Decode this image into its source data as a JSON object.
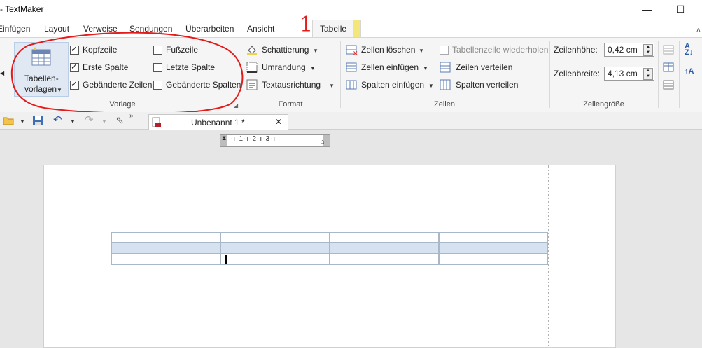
{
  "window": {
    "title": "- TextMaker"
  },
  "tabs": [
    "Einfügen",
    "Layout",
    "Verweise",
    "Sendungen",
    "Überarbeiten",
    "Ansicht",
    "Tabelle"
  ],
  "annotation_number": "1",
  "ribbon": {
    "vorlage": {
      "big_button": {
        "line1": "Tabellen-",
        "line2": "vorlagen"
      },
      "checkboxes": [
        {
          "label": "Kopfzeile",
          "checked": true
        },
        {
          "label": "Erste Spalte",
          "checked": true
        },
        {
          "label": "Gebänderte Zeilen",
          "checked": true
        },
        {
          "label": "Fußzeile",
          "checked": false
        },
        {
          "label": "Letzte Spalte",
          "checked": false
        },
        {
          "label": "Gebänderte Spalten",
          "checked": false
        }
      ],
      "label": "Vorlage"
    },
    "format": {
      "items": [
        "Schattierung",
        "Umrandung",
        "Textausrichtung"
      ],
      "label": "Format"
    },
    "zellen": {
      "items": [
        "Zellen löschen",
        "Zellen einfügen",
        "Spalten einfügen"
      ],
      "right_items": [
        "Tabellenzeile wiederholen",
        "Zeilen verteilen",
        "Spalten verteilen"
      ],
      "label": "Zellen"
    },
    "zellengroesse": {
      "hoehe_label": "Zeilenhöhe:",
      "hoehe_value": "0,42 cm",
      "breite_label": "Zellenbreite:",
      "breite_value": "4,13 cm",
      "label": "Zellengröße"
    }
  },
  "document_tab": {
    "name": "Unbenannt 1 *",
    "close": "✕"
  },
  "ruler": {
    "ticks": [
      "1",
      "2",
      "3"
    ]
  },
  "colors": {
    "annotation_red": "#e31b1b",
    "tab_highlight": "#f3e67a",
    "band_row": "#d6e2f0"
  }
}
